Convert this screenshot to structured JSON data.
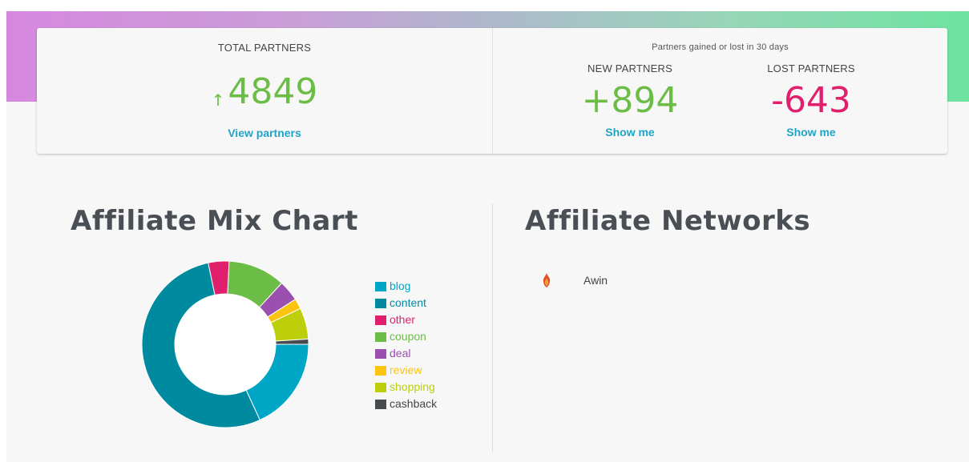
{
  "stats": {
    "total_label": "TOTAL PARTNERS",
    "total_value": "4849",
    "total_arrow": "↑",
    "view_partners": "View partners",
    "change_caption": "Partners gained or lost in 30 days",
    "new_label": "NEW PARTNERS",
    "new_value": "+894",
    "new_link": "Show me",
    "lost_label": "LOST PARTNERS",
    "lost_value": "-643",
    "lost_link": "Show me"
  },
  "mix": {
    "title": "Affiliate Mix Chart"
  },
  "networks": {
    "title": "Affiliate Networks",
    "items": [
      {
        "name": "Awin",
        "icon": "flame-icon"
      }
    ]
  },
  "colors": {
    "green": "#6cbd45",
    "pink": "#e01f6d",
    "link": "#1ea5c5"
  },
  "chart_data": {
    "type": "pie",
    "categories": [
      "blog",
      "content",
      "other",
      "coupon",
      "deal",
      "review",
      "shopping",
      "cashback"
    ],
    "values": [
      18,
      53,
      4,
      11,
      4,
      2,
      6,
      1
    ],
    "colors": [
      "#00a6c6",
      "#008aa0",
      "#e01f6d",
      "#6cbd45",
      "#9b4fae",
      "#fcc40e",
      "#bdcf0a",
      "#474b4f"
    ],
    "legend_position": "right"
  }
}
